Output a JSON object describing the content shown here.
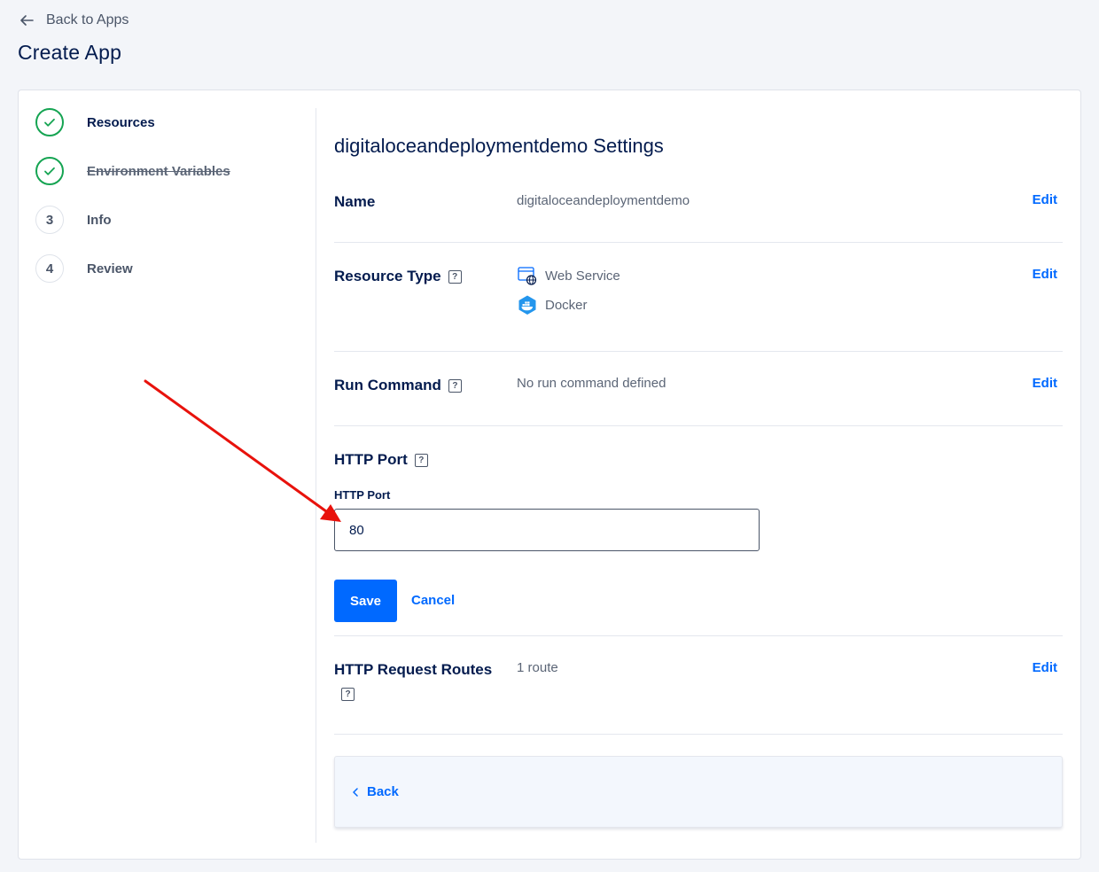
{
  "nav": {
    "back_label": "Back to Apps"
  },
  "page": {
    "title": "Create App"
  },
  "steps": [
    {
      "label": "Resources",
      "status": "done"
    },
    {
      "label": "Environment Variables",
      "status": "done"
    },
    {
      "number": "3",
      "label": "Info",
      "status": "pending"
    },
    {
      "number": "4",
      "label": "Review",
      "status": "pending"
    }
  ],
  "settings": {
    "title": "digitaloceandeploymentdemo Settings",
    "edit_label": "Edit",
    "name": {
      "label": "Name",
      "value": "digitaloceandeploymentdemo"
    },
    "resource_type": {
      "label": "Resource Type",
      "items": [
        {
          "label": "Web Service",
          "icon": "web-service-icon"
        },
        {
          "label": "Docker",
          "icon": "docker-icon"
        }
      ]
    },
    "run_command": {
      "label": "Run Command",
      "value": "No run command defined"
    },
    "http_port": {
      "label": "HTTP Port",
      "field_label": "HTTP Port",
      "value": "80",
      "save_label": "Save",
      "cancel_label": "Cancel"
    },
    "http_routes": {
      "label": "HTTP Request Routes",
      "value": "1 route"
    }
  },
  "footer": {
    "back_label": "Back"
  },
  "colors": {
    "accent": "#0069ff",
    "success": "#15a452",
    "annotation_arrow": "#e8120c"
  }
}
